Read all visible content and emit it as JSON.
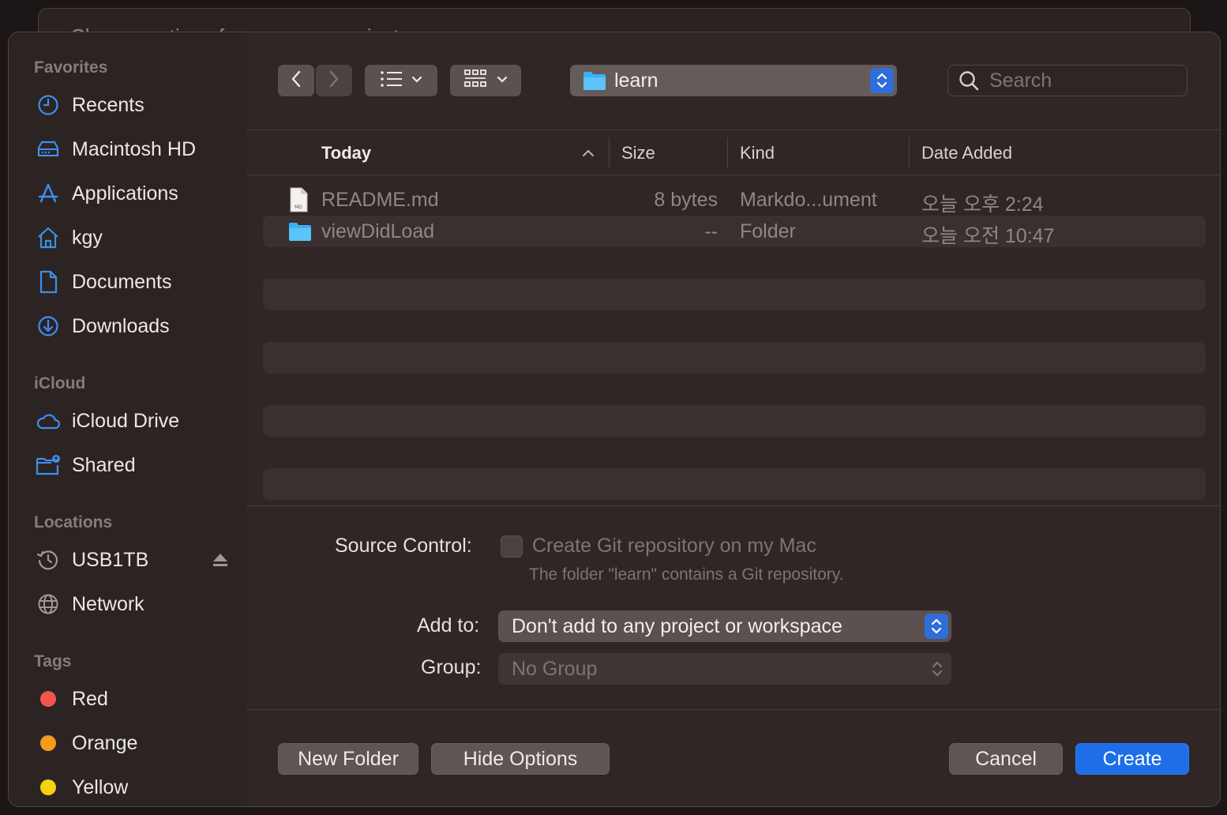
{
  "background_window": {
    "title": "Choose options for your new project:"
  },
  "sidebar": {
    "favorites_title": "Favorites",
    "favorites": [
      {
        "label": "Recents",
        "icon": "clock-icon"
      },
      {
        "label": "Macintosh HD",
        "icon": "disk-icon"
      },
      {
        "label": "Applications",
        "icon": "applications-icon"
      },
      {
        "label": "kgy",
        "icon": "home-icon"
      },
      {
        "label": "Documents",
        "icon": "document-icon"
      },
      {
        "label": "Downloads",
        "icon": "download-icon"
      }
    ],
    "icloud_title": "iCloud",
    "icloud": [
      {
        "label": "iCloud Drive",
        "icon": "cloud-icon"
      },
      {
        "label": "Shared",
        "icon": "shared-folder-icon"
      }
    ],
    "locations_title": "Locations",
    "locations": [
      {
        "label": "USB1TB",
        "icon": "time-machine-icon"
      },
      {
        "label": "Network",
        "icon": "globe-icon"
      }
    ],
    "tags_title": "Tags",
    "tags": [
      {
        "label": "Red",
        "color": "#f0564f"
      },
      {
        "label": "Orange",
        "color": "#f59a1b"
      },
      {
        "label": "Yellow",
        "color": "#f5d20e"
      }
    ]
  },
  "toolbar": {
    "path": "learn",
    "search_placeholder": "Search"
  },
  "table": {
    "columns": [
      "Today",
      "Size",
      "Kind",
      "Date Added"
    ],
    "rows": [
      {
        "name": "README.md",
        "size": "8 bytes",
        "kind": "Markdo...ument",
        "date": "오늘 오후 2:24",
        "icon": "markdown-file-icon"
      },
      {
        "name": "viewDidLoad",
        "size": "--",
        "kind": "Folder",
        "date": "오늘 오전 10:47",
        "icon": "folder-icon"
      }
    ]
  },
  "options": {
    "source_control_label": "Source Control:",
    "git_checkbox_label": "Create Git repository on my Mac",
    "git_note": "The folder \"learn\" contains a Git repository.",
    "add_to_label": "Add to:",
    "add_to_value": "Don't add to any project or workspace",
    "group_label": "Group:",
    "group_value": "No Group"
  },
  "buttons": {
    "new_folder": "New Folder",
    "hide_options": "Hide Options",
    "cancel": "Cancel",
    "create": "Create"
  },
  "colors": {
    "accent": "#1d6ee8",
    "sidebar_icon": "#3d8ef0"
  }
}
